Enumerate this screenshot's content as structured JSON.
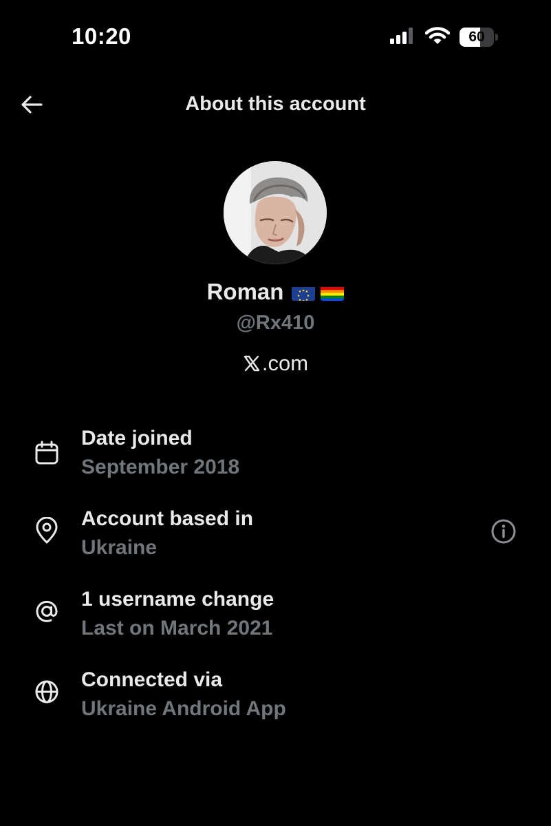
{
  "status_bar": {
    "time": "10:20",
    "battery_level": "60",
    "battery_fraction": 0.6,
    "icons": [
      "cellular-signal-icon",
      "wifi-icon",
      "battery-icon"
    ]
  },
  "header": {
    "title": "About this account",
    "back_icon": "arrow-left-icon"
  },
  "profile": {
    "display_name": "Roman",
    "badges": [
      "eu-flag-emoji",
      "rainbow-flag-emoji"
    ],
    "handle": "@Rx410",
    "site_label": ".com",
    "site_logo": "x-logo-icon"
  },
  "details": [
    {
      "icon": "calendar-icon",
      "label": "Date joined",
      "value": "September 2018"
    },
    {
      "icon": "location-pin-icon",
      "label": "Account based in",
      "value": "Ukraine",
      "action_icon": "info-icon"
    },
    {
      "icon": "at-sign-icon",
      "label": "1 username change",
      "value": "Last on March 2021"
    },
    {
      "icon": "globe-icon",
      "label": "Connected via",
      "value": "Ukraine Android App"
    }
  ],
  "colors": {
    "background": "#000000",
    "primary_text": "#e7e9ea",
    "secondary_text": "#71767b"
  }
}
